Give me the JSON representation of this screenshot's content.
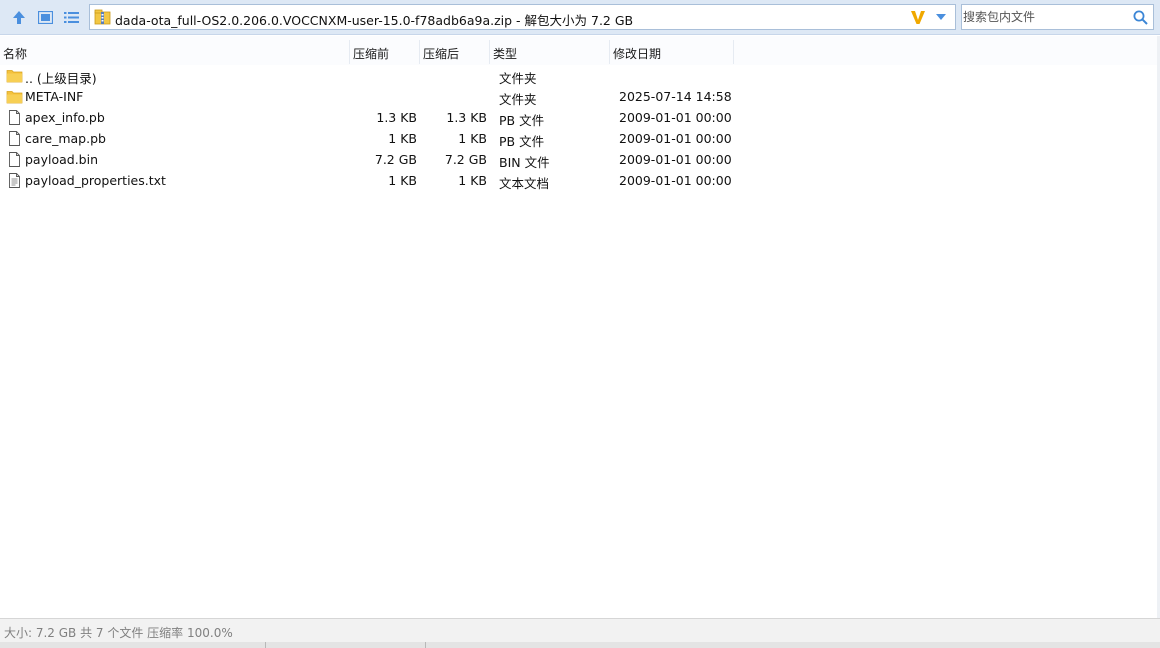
{
  "toolbar": {
    "up_icon": "arrow-up-icon",
    "view_icon": "view-icon",
    "list_icon": "list-icon",
    "address_text": "dada-ota_full-OS2.0.206.0.VOCCNXM-user-15.0-f78adb6a9a.zip - 解包大小为 7.2 GB",
    "address_icon": "zip-archive-icon",
    "v_icon": "v-logo-icon",
    "dropdown_icon": "chevron-down-icon",
    "search_placeholder": "搜索包内文件",
    "search_icon": "search-icon"
  },
  "columns": {
    "name": "名称",
    "compressed": "压缩前",
    "original": "压缩后",
    "type": "类型",
    "modified": "修改日期"
  },
  "files": [
    {
      "name": ".. (上级目录)",
      "compressed": "",
      "original": "",
      "type": "文件夹",
      "date": "",
      "icon": "folder-icon"
    },
    {
      "name": "META-INF",
      "compressed": "",
      "original": "",
      "type": "文件夹",
      "date": "2025-07-14 14:58",
      "icon": "folder-icon"
    },
    {
      "name": "apex_info.pb",
      "compressed": "1.3 KB",
      "original": "1.3 KB",
      "type": "PB 文件",
      "date": "2009-01-01 00:00",
      "icon": "file-icon"
    },
    {
      "name": "care_map.pb",
      "compressed": "1 KB",
      "original": "1 KB",
      "type": "PB 文件",
      "date": "2009-01-01 00:00",
      "icon": "file-icon"
    },
    {
      "name": "payload.bin",
      "compressed": "7.2 GB",
      "original": "7.2 GB",
      "type": "BIN 文件",
      "date": "2009-01-01 00:00",
      "icon": "file-icon"
    },
    {
      "name": "payload_properties.txt",
      "compressed": "1 KB",
      "original": "1 KB",
      "type": "文本文档",
      "date": "2009-01-01 00:00",
      "icon": "text-file-icon"
    }
  ],
  "status": {
    "text": "大小: 7.2 GB 共 7 个文件 压缩率 100.0%"
  },
  "colors": {
    "toolbar_bg": "#dde8f5",
    "accent_blue": "#3b86d6",
    "folder_yellow": "#f4c23d",
    "v_logo": "#f0a800"
  }
}
